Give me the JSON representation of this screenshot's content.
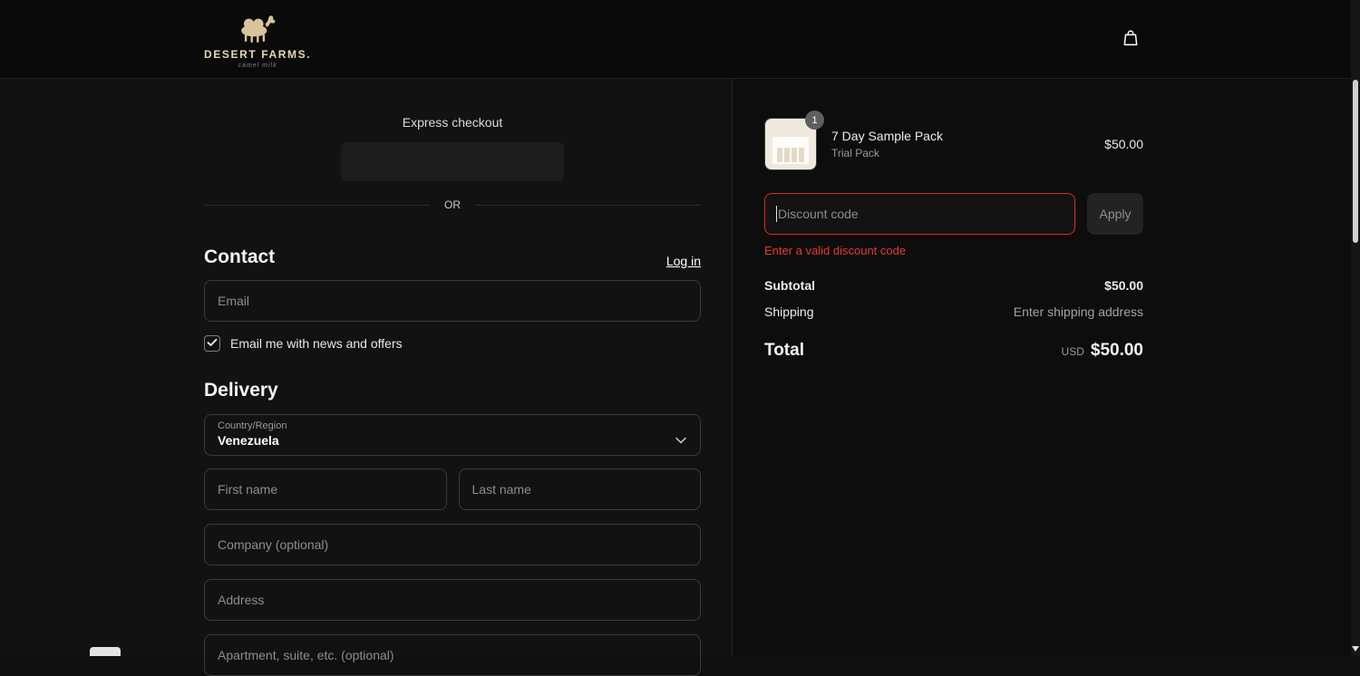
{
  "header": {
    "logo_text": "DESERT FARMS.",
    "logo_tagline": "camel milk"
  },
  "express": {
    "title": "Express checkout",
    "or": "OR"
  },
  "contact": {
    "heading": "Contact",
    "login": "Log in",
    "email_placeholder": "Email",
    "newsletter_label": "Email me with news and offers",
    "newsletter_checked": true
  },
  "delivery": {
    "heading": "Delivery",
    "country_label": "Country/Region",
    "country_value": "Venezuela",
    "first_name_placeholder": "First name",
    "last_name_placeholder": "Last name",
    "company_placeholder": "Company (optional)",
    "address_placeholder": "Address",
    "apartment_placeholder": "Apartment, suite, etc. (optional)"
  },
  "summary": {
    "quantity_badge": "1",
    "product_title": "7 Day Sample Pack",
    "product_variant": "Trial Pack",
    "product_price": "$50.00",
    "discount_placeholder": "Discount code",
    "apply_label": "Apply",
    "discount_error": "Enter a valid discount code",
    "subtotal_label": "Subtotal",
    "subtotal_value": "$50.00",
    "shipping_label": "Shipping",
    "shipping_value": "Enter shipping address",
    "total_label": "Total",
    "currency": "USD",
    "total_value": "$50.00"
  },
  "colors": {
    "error_text": "#e23c32",
    "error_border": "#dd2a1f",
    "brand_text": "#e6d7b2",
    "background_left": "#121212",
    "background_right": "#0d0d0d"
  },
  "icons": {
    "cart": "shopping-bag-icon",
    "logo": "camel-logo-icon",
    "select": "chevron-down-icon",
    "newsletter": "check-icon"
  }
}
